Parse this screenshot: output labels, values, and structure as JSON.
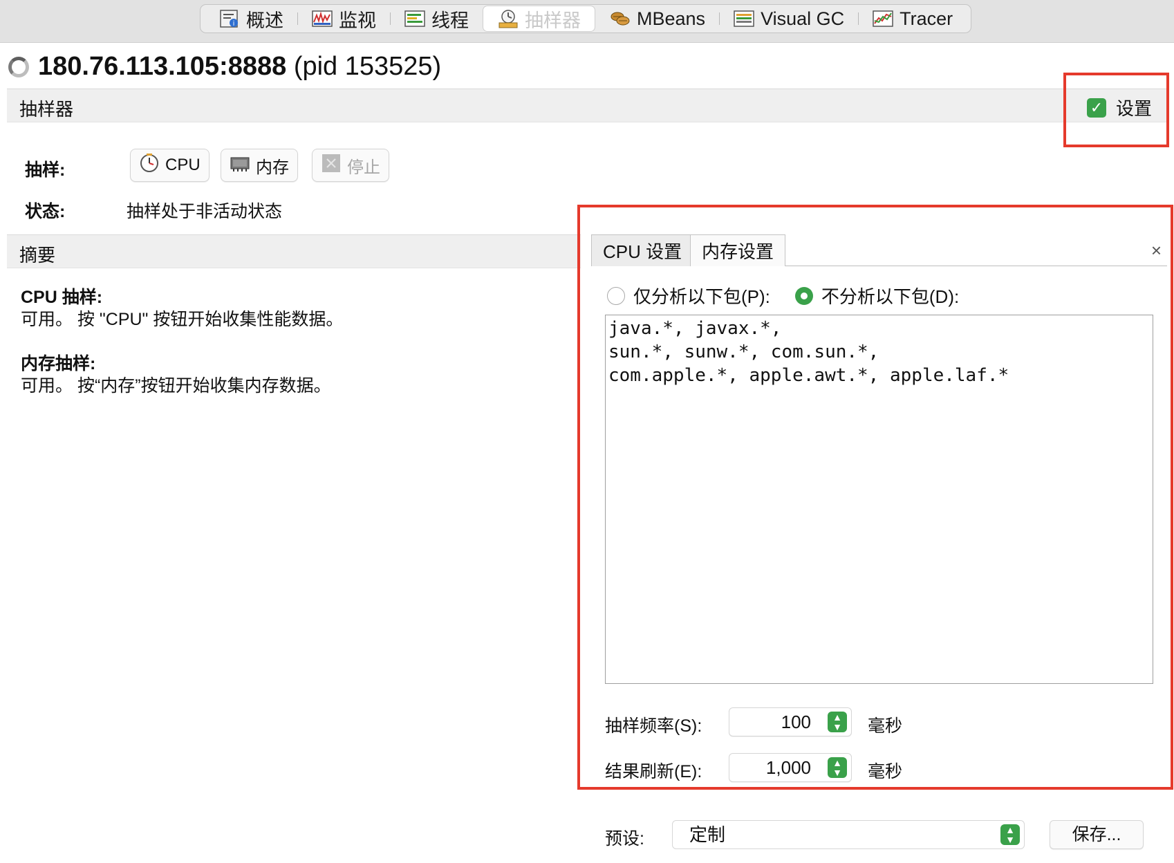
{
  "top_tabs": [
    {
      "label": "概述",
      "icon": "overview-icon"
    },
    {
      "label": "监视",
      "icon": "monitor-icon"
    },
    {
      "label": "线程",
      "icon": "threads-icon"
    },
    {
      "label": "抽样器",
      "icon": "sampler-icon",
      "active": true
    },
    {
      "label": "MBeans",
      "icon": "mbeans-icon"
    },
    {
      "label": "Visual GC",
      "icon": "visual-gc-icon"
    },
    {
      "label": "Tracer",
      "icon": "tracer-icon"
    }
  ],
  "title": {
    "host": "180.76.113.105:8888",
    "pid": "(pid 153525)"
  },
  "sampler": {
    "header": "抽样器",
    "settings_label": "设置",
    "settings_checked": true,
    "sample_label": "抽样:",
    "buttons": {
      "cpu": "CPU",
      "memory": "内存",
      "stop": "停止"
    },
    "status_label": "状态:",
    "status_value": "抽样处于非活动状态"
  },
  "summary": {
    "header": "摘要",
    "cpu_title": "CPU 抽样:",
    "cpu_text": "可用。 按 \"CPU\" 按钮开始收集性能数据。",
    "mem_title": "内存抽样:",
    "mem_text": "可用。 按“内存”按钮开始收集内存数据。"
  },
  "settings": {
    "tabs": [
      "CPU 设置",
      "内存设置"
    ],
    "close": "×",
    "radio_include": "仅分析以下包(P):",
    "radio_exclude": "不分析以下包(D):",
    "selected_radio": "exclude",
    "packages": "java.*, javax.*,\nsun.*, sunw.*, com.sun.*,\ncom.apple.*, apple.awt.*, apple.laf.*",
    "sample_rate_label": "抽样频率(S):",
    "sample_rate_value": "100",
    "refresh_label": "结果刷新(E):",
    "refresh_value": "1,000",
    "unit": "毫秒",
    "preset_label": "预设:",
    "preset_value": "定制",
    "save_label": "保存..."
  },
  "colors": {
    "accent_green": "#3aa14a",
    "highlight_red": "#e53a2c"
  }
}
